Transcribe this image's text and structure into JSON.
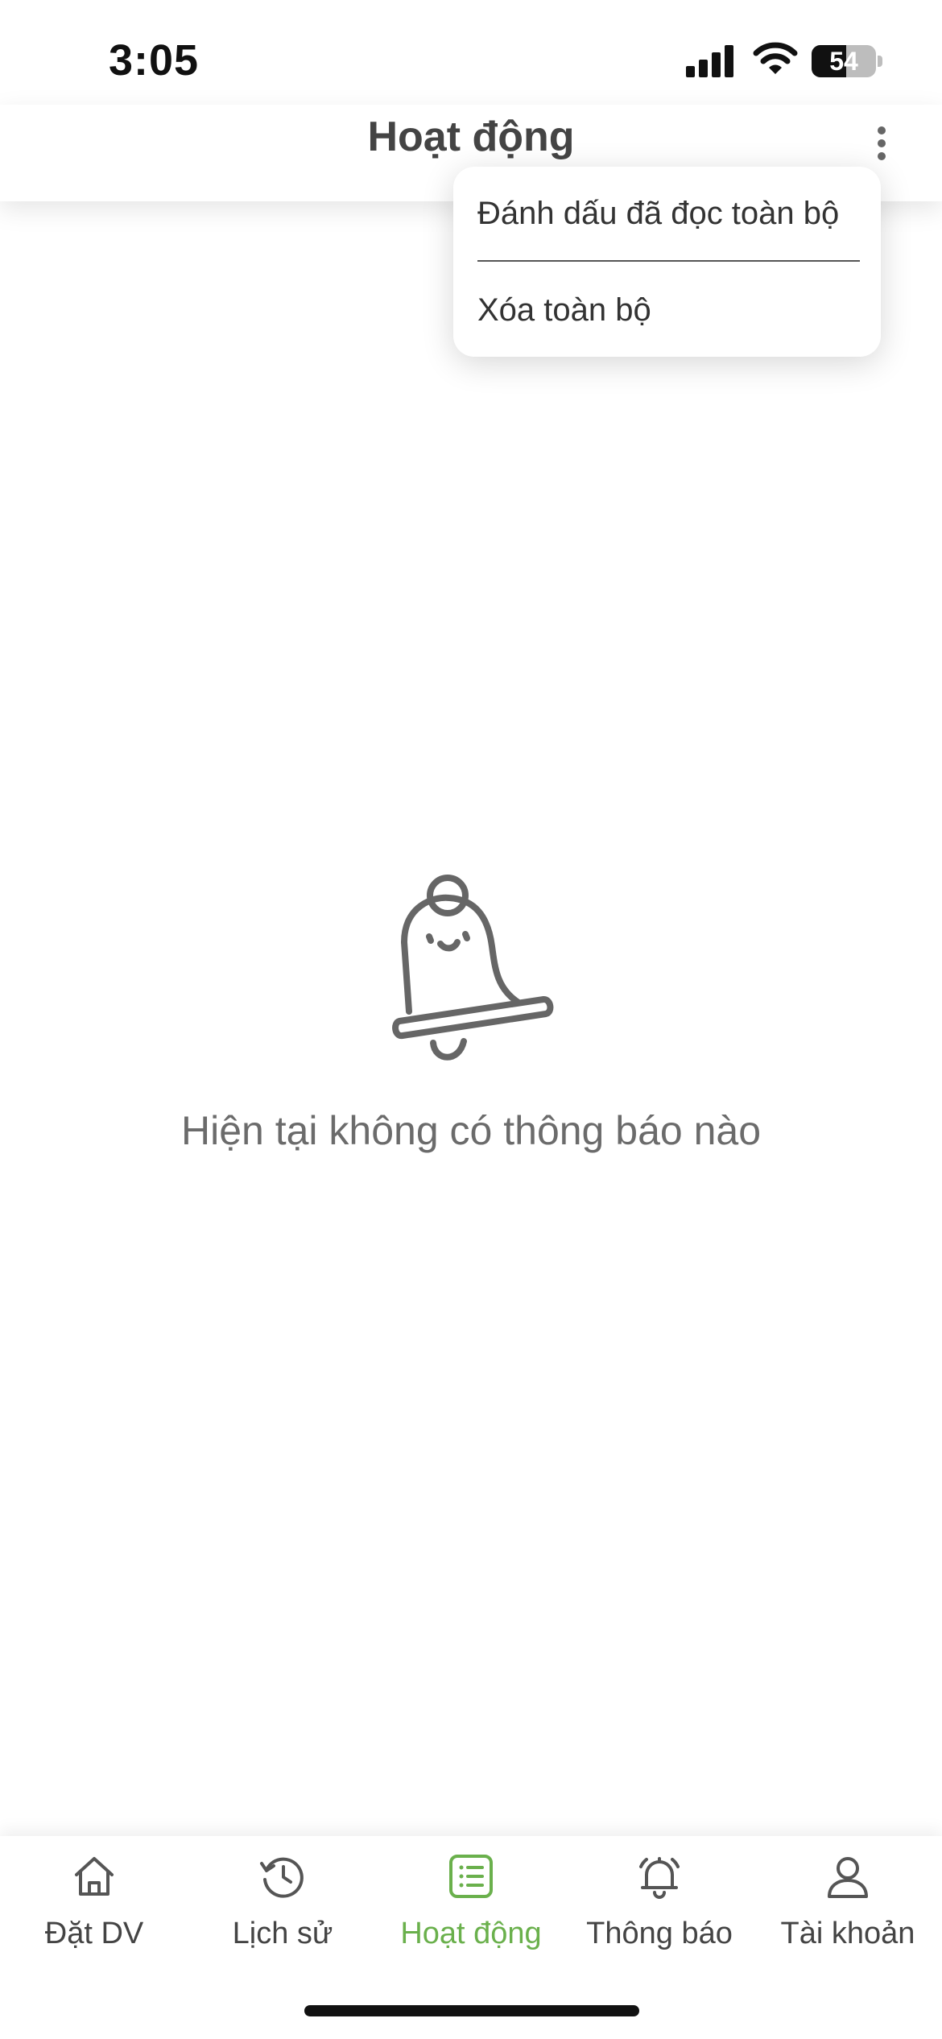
{
  "status_bar": {
    "time": "3:05",
    "battery_level": "54",
    "battery_fraction": 0.54,
    "icons": [
      "signal-icon",
      "wifi-icon",
      "battery-icon"
    ]
  },
  "header": {
    "title": "Hoạt động",
    "more_icon": "more-vertical-icon"
  },
  "dropdown": {
    "items": [
      {
        "label": "Đánh dấu đã đọc toàn bộ"
      },
      {
        "label": "Xóa toàn bộ"
      }
    ]
  },
  "empty_state": {
    "icon": "bell-icon",
    "message": "Hiện tại không có thông báo nào"
  },
  "bottom_nav": {
    "active_color": "#6ab04c",
    "items": [
      {
        "label": "Đặt DV",
        "icon": "home-icon",
        "active": false
      },
      {
        "label": "Lịch sử",
        "icon": "history-icon",
        "active": false
      },
      {
        "label": "Hoạt động",
        "icon": "list-icon",
        "active": true
      },
      {
        "label": "Thông báo",
        "icon": "bell-icon",
        "active": false
      },
      {
        "label": "Tài khoản",
        "icon": "user-icon",
        "active": false
      }
    ]
  }
}
